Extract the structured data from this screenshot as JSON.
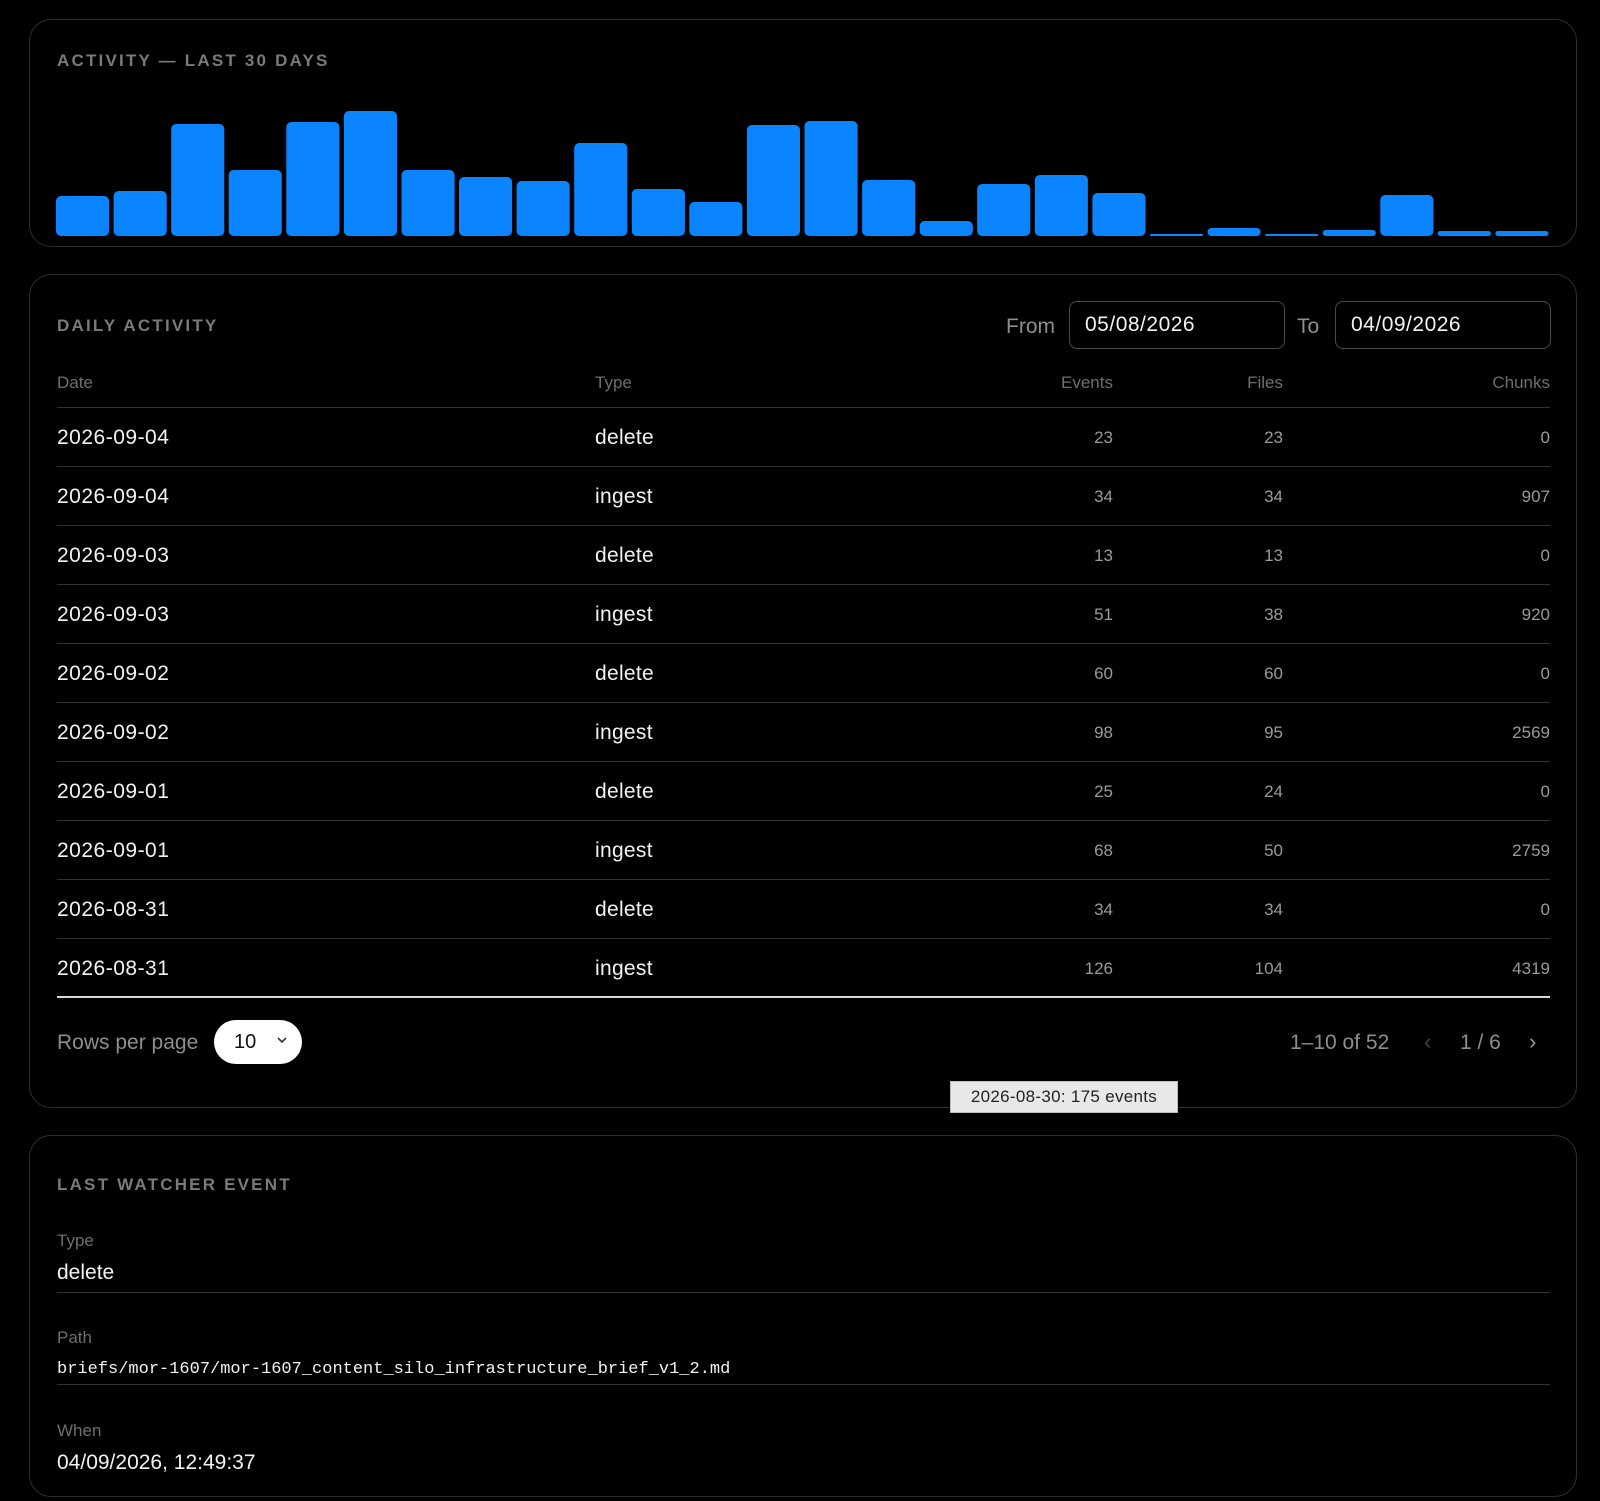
{
  "activity": {
    "title": "ACTIVITY — LAST 30 DAYS"
  },
  "chart_data": {
    "type": "bar",
    "title": "ACTIVITY — LAST 30 DAYS",
    "color": "#0a84ff",
    "values": [
      40,
      45,
      112,
      66,
      114,
      125,
      66,
      59,
      55,
      93,
      47,
      34,
      111,
      115,
      56,
      15,
      52,
      61,
      43,
      2,
      8,
      2,
      6,
      41,
      5,
      5
    ],
    "ylim": [
      0,
      125
    ],
    "grid": false
  },
  "daily": {
    "title": "DAILY ACTIVITY",
    "from_label": "From",
    "from_value": "05/08/2026",
    "to_label": "To",
    "to_value": "04/09/2026",
    "columns": [
      "Date",
      "Type",
      "Events",
      "Files",
      "Chunks"
    ],
    "rows": [
      {
        "date": "2026-09-04",
        "type": "delete",
        "events": "23",
        "files": "23",
        "chunks": "0"
      },
      {
        "date": "2026-09-04",
        "type": "ingest",
        "events": "34",
        "files": "34",
        "chunks": "907"
      },
      {
        "date": "2026-09-03",
        "type": "delete",
        "events": "13",
        "files": "13",
        "chunks": "0"
      },
      {
        "date": "2026-09-03",
        "type": "ingest",
        "events": "51",
        "files": "38",
        "chunks": "920"
      },
      {
        "date": "2026-09-02",
        "type": "delete",
        "events": "60",
        "files": "60",
        "chunks": "0"
      },
      {
        "date": "2026-09-02",
        "type": "ingest",
        "events": "98",
        "files": "95",
        "chunks": "2569"
      },
      {
        "date": "2026-09-01",
        "type": "delete",
        "events": "25",
        "files": "24",
        "chunks": "0"
      },
      {
        "date": "2026-09-01",
        "type": "ingest",
        "events": "68",
        "files": "50",
        "chunks": "2759"
      },
      {
        "date": "2026-08-31",
        "type": "delete",
        "events": "34",
        "files": "34",
        "chunks": "0"
      },
      {
        "date": "2026-08-31",
        "type": "ingest",
        "events": "126",
        "files": "104",
        "chunks": "4319"
      }
    ],
    "pagination": {
      "rows_label": "Rows per page",
      "rows_value": "10",
      "range": "1–10 of 52",
      "prev": "‹",
      "page": "1 / 6",
      "next": "›"
    }
  },
  "tooltip": "2026-08-30: 175 events",
  "watcher": {
    "title": "LAST WATCHER EVENT",
    "type_label": "Type",
    "type_value": "delete",
    "path_label": "Path",
    "path_value": "briefs/mor-1607/mor-1607_content_silo_infrastructure_brief_v1_2.md",
    "when_label": "When",
    "when_value": "04/09/2026, 12:49:37"
  }
}
